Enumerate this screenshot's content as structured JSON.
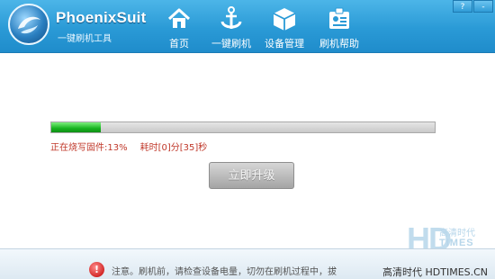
{
  "app": {
    "title": "PhoenixSuit",
    "subtitle": "一键刷机工具"
  },
  "nav": [
    {
      "label": "首页",
      "icon": "home-icon"
    },
    {
      "label": "一键刷机",
      "icon": "anchor-icon"
    },
    {
      "label": "设备管理",
      "icon": "device-box-icon"
    },
    {
      "label": "刷机帮助",
      "icon": "help-card-icon"
    }
  ],
  "window_buttons": {
    "help": "?",
    "minimize": "-"
  },
  "progress": {
    "percent": 13,
    "status_label": "正在烧写固件:13%",
    "elapsed_label": "耗时[0]分[35]秒"
  },
  "upgrade_button": {
    "label": "立即升级"
  },
  "footer": {
    "notice": "注意。刷机前，请检查设备电量，切勿在刷机过程中，拔"
  },
  "watermark": {
    "logo_text": "HD",
    "logo_cn": "高清时代",
    "logo_en": "TIMES",
    "caption": "高清时代 HDTIMES.CN"
  },
  "colors": {
    "header": "#2a9ad6",
    "progress_fill": "#17b31f",
    "status_text": "#c0392b",
    "button_disabled": "#a4a4a4"
  }
}
